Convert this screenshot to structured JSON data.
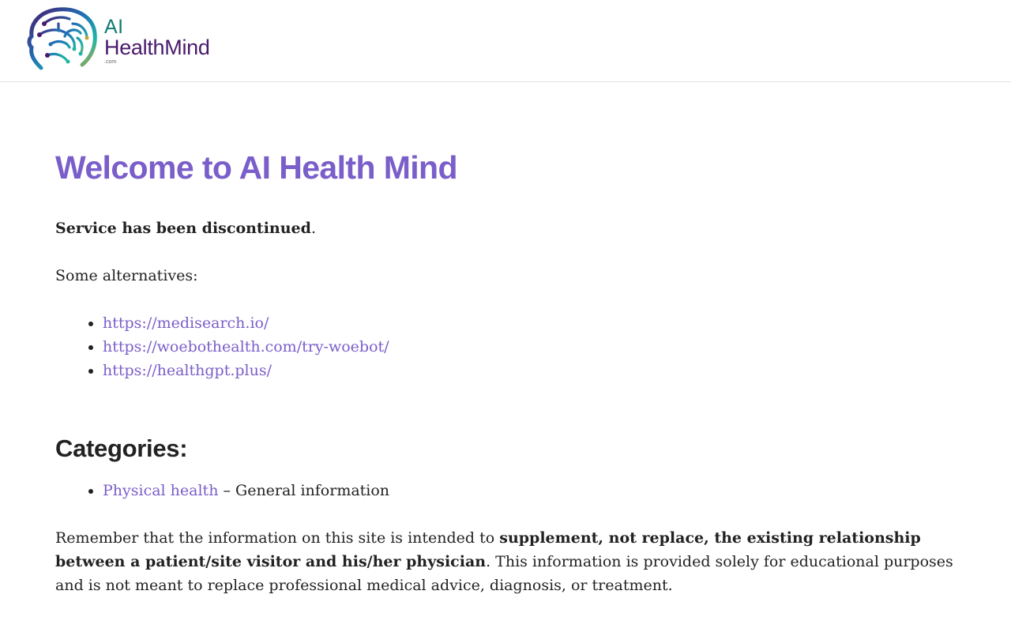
{
  "header": {
    "logo": {
      "line1": "AI",
      "line2": "HealthMind",
      "line3": ".com"
    }
  },
  "main": {
    "title": "Welcome to AI Health Mind",
    "notice_bold": "Service has been discontinued",
    "notice_punct": ".",
    "alternatives_intro": "Some alternatives:",
    "alternatives": [
      {
        "label": "https://medisearch.io/"
      },
      {
        "label": "https://woebothealth.com/try-woebot/"
      },
      {
        "label": "https://healthgpt.plus/"
      }
    ],
    "categories_heading": "Categories:",
    "categories": [
      {
        "label": "Physical health",
        "description": " – General information"
      }
    ],
    "disclaimer": {
      "lead": "Remember that the information on this site is intended to ",
      "bold": "supplement, not replace, the existing relationship between a patient/site visitor and his/her physician",
      "tail": ". This information is provided solely for educational purposes and is not meant to replace professional medical advice, diagnosis, or treatment."
    }
  },
  "colors": {
    "accent": "#7a5ec9",
    "text": "#222222",
    "logo_teal": "#127a73",
    "logo_purple": "#4a1a6b"
  },
  "icons": {
    "logo_mark": "brain-circuit-head-icon"
  }
}
